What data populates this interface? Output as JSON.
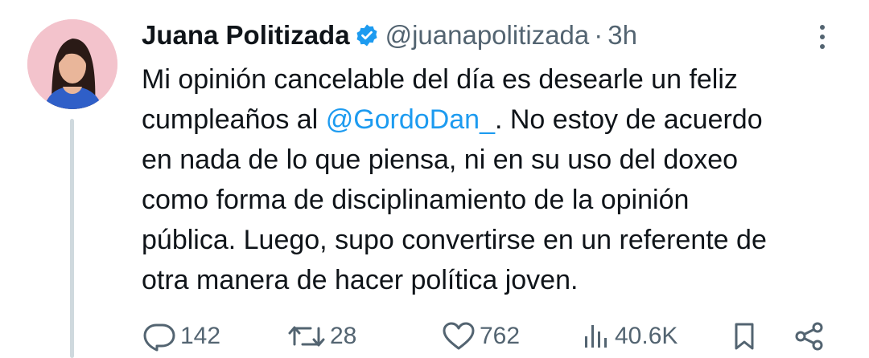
{
  "tweet": {
    "author_name": "Juana Politizada",
    "handle": "@juanapolitizada",
    "separator": "·",
    "time": "3h",
    "body_lines": [
      "Mi opinión cancelable del día es desearle un feliz",
      "cumpleaños al ",
      "@GordoDan_",
      ". No estoy de acuerdo",
      "en nada de lo que piensa, ni en su uso del doxeo",
      "como forma de disciplinamiento de la opinión",
      "pública. Luego, supo convertirse en un referente de",
      "otra manera de hacer política joven."
    ]
  },
  "actions": {
    "replies": "142",
    "retweets": "28",
    "likes": "762",
    "views": "40.6K"
  },
  "colors": {
    "accent": "#1d9bf0",
    "secondary_text": "#536471",
    "thread_line": "#cfd9de"
  },
  "icons": [
    "verified-badge-icon",
    "more-options-icon",
    "reply-icon",
    "retweet-icon",
    "like-icon",
    "views-icon",
    "bookmark-icon",
    "share-icon"
  ]
}
